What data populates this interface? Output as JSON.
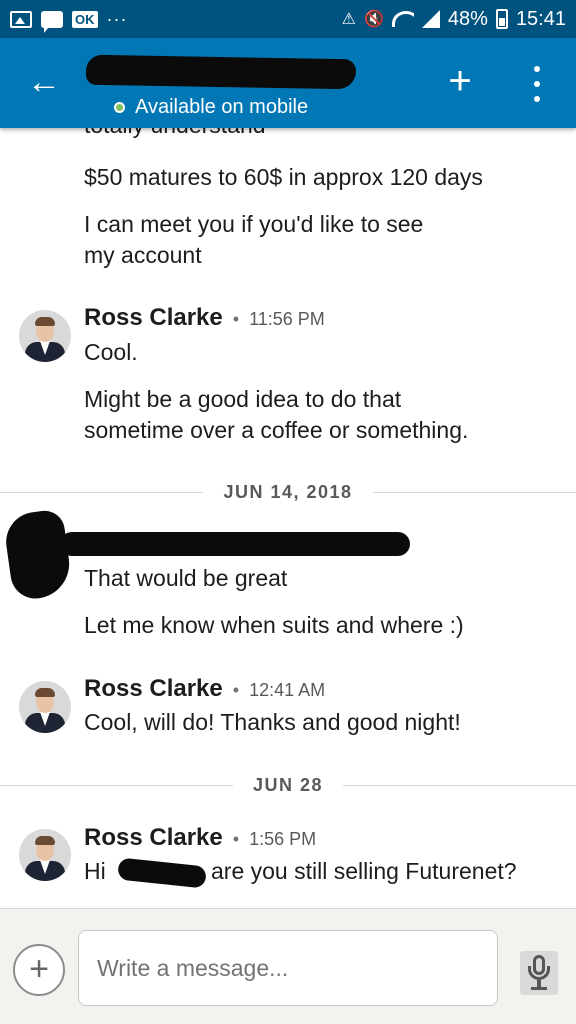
{
  "status_bar": {
    "battery": "48%",
    "time": "15:41",
    "dots": "···",
    "alert": "⚠",
    "mute": "🔇",
    "ok_badge": "OK"
  },
  "app_bar": {
    "back_icon": "←",
    "status_text": "Available on mobile",
    "plus_icon": "+"
  },
  "conversation": {
    "cut_line": "totally understand",
    "first_messages": [
      "$50 matures to 60$ in approx 120 days",
      "I can meet you if you'd like to see",
      "my account"
    ],
    "group1": {
      "sender": "Ross Clarke",
      "sep": "•",
      "time": "11:56 PM",
      "messages": [
        "Cool.",
        "Might be a good idea to do that",
        "sometime over a coffee or something."
      ]
    },
    "divider1": "JUN 14, 2018",
    "group2": {
      "messages": [
        "That would be great",
        "Let me know when suits and where :)"
      ]
    },
    "group3": {
      "sender": "Ross Clarke",
      "sep": "•",
      "time": "12:41 AM",
      "messages": [
        "Cool, will do! Thanks and good night!"
      ]
    },
    "divider2": "JUN 28",
    "group4": {
      "sender": "Ross Clarke",
      "sep": "•",
      "time": "1:56 PM",
      "msg_start": "Hi",
      "msg_end": "are you still selling Futurenet?"
    }
  },
  "compose": {
    "attach_icon": "+",
    "placeholder": "Write a message..."
  },
  "icons": {
    "status": [
      "image-icon",
      "chat-icon",
      "ok-icon",
      "alert-icon",
      "mute-icon",
      "wifi-icon",
      "signal-icon",
      "battery-icon"
    ],
    "app_bar": [
      "back-arrow-icon",
      "presence-dot-icon",
      "plus-icon",
      "more-vert-icon"
    ],
    "compose": [
      "add-icon",
      "mic-icon"
    ]
  },
  "colors": {
    "status_bar_bg": "#00527f",
    "app_bar_bg": "#0277b5",
    "presence_green": "#7fc15e",
    "compose_bg": "#f3f2ef"
  }
}
